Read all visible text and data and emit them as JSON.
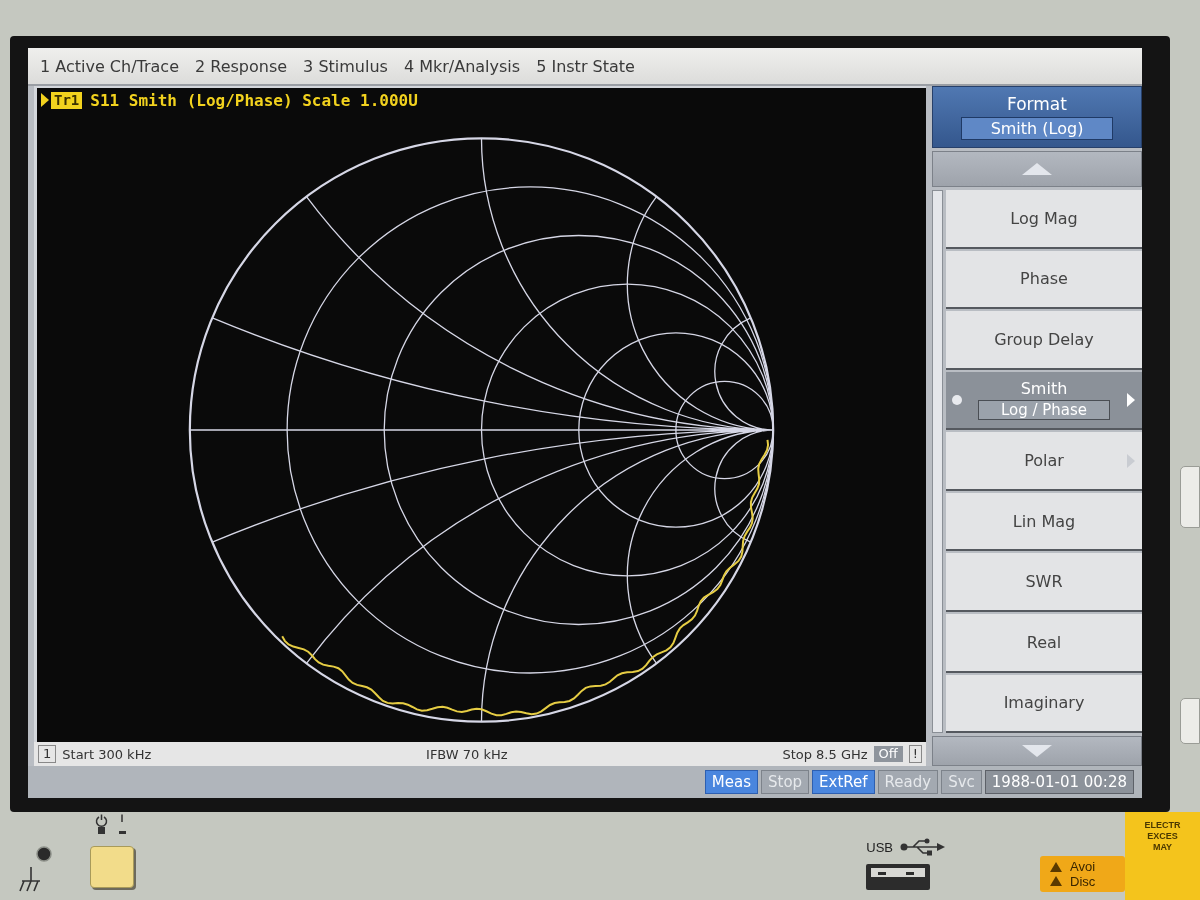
{
  "menu_bar": {
    "items": [
      "1 Active Ch/Trace",
      "2 Response",
      "3 Stimulus",
      "4 Mkr/Analysis",
      "5 Instr State"
    ]
  },
  "trace": {
    "active": true,
    "tag": "Tr1",
    "label": "S11 Smith (Log/Phase) Scale 1.000U"
  },
  "channel_bar": {
    "channel": "1",
    "start": "Start 300 kHz",
    "ifbw": "IFBW 70 kHz",
    "stop": "Stop 8.5 GHz",
    "badge": "Off",
    "flag": "!"
  },
  "softkeys": {
    "title": "Format",
    "value": "Smith (Log)",
    "items": [
      {
        "label": "Log Mag",
        "selected": false,
        "submenu": false
      },
      {
        "label": "Phase",
        "selected": false,
        "submenu": false
      },
      {
        "label": "Group Delay",
        "selected": false,
        "submenu": false
      },
      {
        "label": "Smith",
        "value": "Log / Phase",
        "selected": true,
        "submenu": true
      },
      {
        "label": "Polar",
        "selected": false,
        "submenu": true
      },
      {
        "label": "Lin Mag",
        "selected": false,
        "submenu": false
      },
      {
        "label": "SWR",
        "selected": false,
        "submenu": false
      },
      {
        "label": "Real",
        "selected": false,
        "submenu": false
      },
      {
        "label": "Imaginary",
        "selected": false,
        "submenu": false
      }
    ]
  },
  "status_bar": {
    "indicators": [
      {
        "label": "Meas",
        "on": true
      },
      {
        "label": "Stop",
        "on": false
      },
      {
        "label": "ExtRef",
        "on": true
      },
      {
        "label": "Ready",
        "on": false
      },
      {
        "label": "Svc",
        "on": false
      }
    ],
    "clock": "1988-01-01 00:28"
  },
  "front_panel": {
    "usb_label": "USB",
    "caution_label": [
      "Avoi",
      "Disc"
    ],
    "warning_sticker": [
      "ELECTR",
      "EXCES",
      "MAY"
    ]
  }
}
